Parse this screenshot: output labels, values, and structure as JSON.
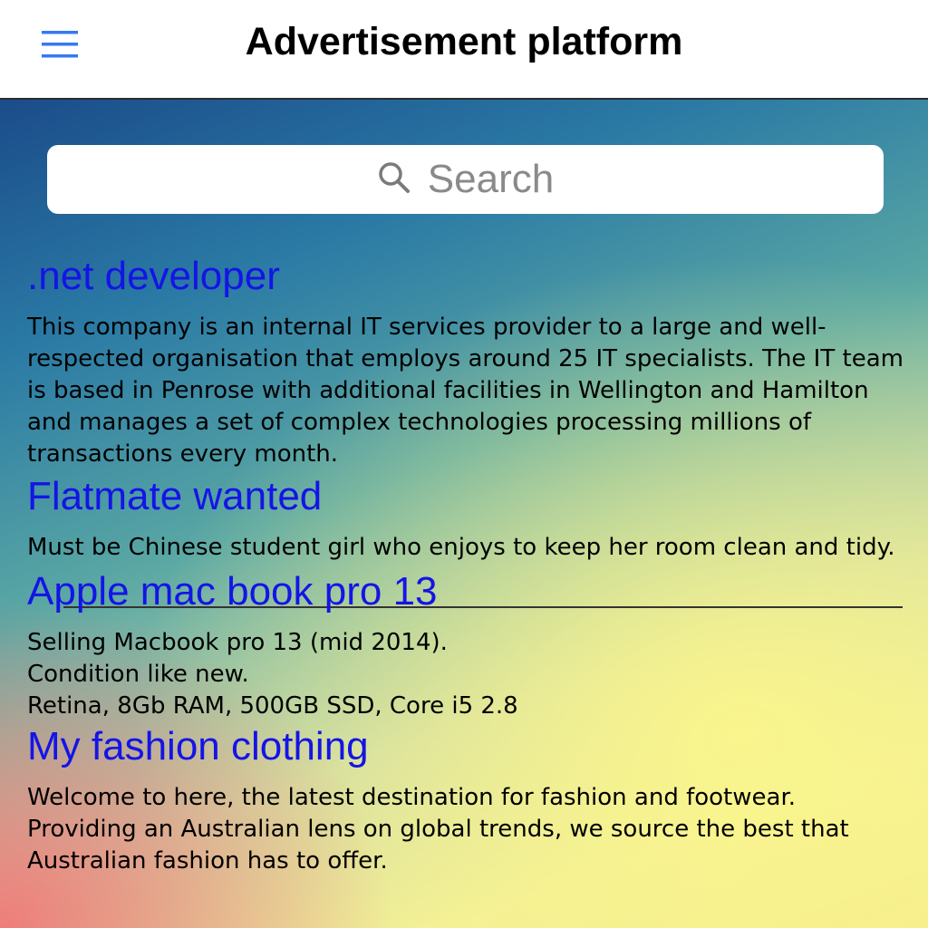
{
  "nav": {
    "title": "Advertisement platform",
    "menu_icon": "hamburger-menu-icon",
    "accent_color": "#3478f6"
  },
  "search": {
    "placeholder": "Search",
    "icon": "search-icon"
  },
  "ads": [
    {
      "title": ".net developer",
      "description": "This company is an internal IT services provider to a large and well-respected organisation that employs around 25 IT specialists. The IT team is based in Penrose with additional facilities in Wellington and Hamilton and manages a set of complex technologies processing millions of transactions every month."
    },
    {
      "title": "Flatmate wanted",
      "description": "Must be Chinese student girl who enjoys to keep her room clean and tidy."
    },
    {
      "title": "Apple mac book pro 13",
      "description": "Selling Macbook pro 13 (mid 2014).\nCondition like new.\nRetina, 8Gb RAM, 500GB SSD, Core i5 2.8"
    },
    {
      "title": "My fashion clothing",
      "description": "Welcome to here, the latest destination for fashion and footwear. Providing an Australian lens on global trends, we source the best that Australian fashion has to offer."
    }
  ],
  "colors": {
    "title_link": "#1414e6"
  }
}
